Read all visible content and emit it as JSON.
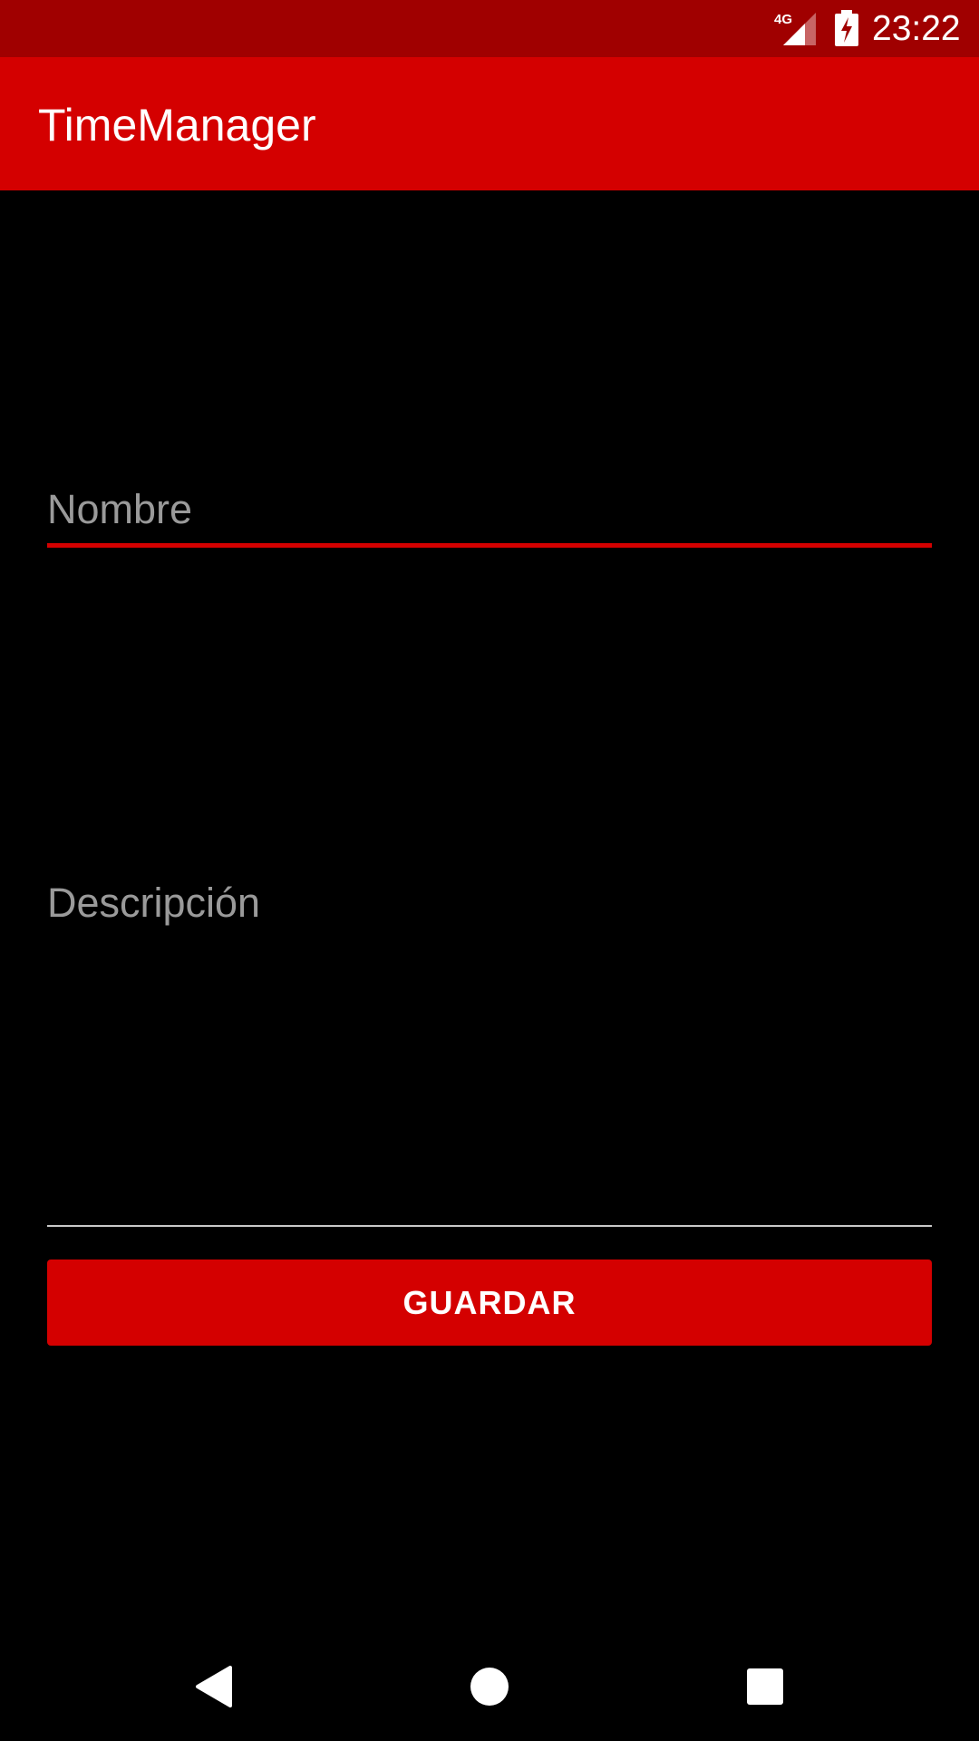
{
  "status_bar": {
    "network_label": "4G",
    "time": "23:22"
  },
  "app_bar": {
    "title": "TimeManager"
  },
  "form": {
    "name_field": {
      "placeholder": "Nombre",
      "value": ""
    },
    "description_field": {
      "placeholder": "Descripción",
      "value": ""
    },
    "save_button_label": "GUARDAR"
  },
  "nav_bar": {
    "icons": [
      "back-icon",
      "home-icon",
      "recents-icon"
    ]
  },
  "colors": {
    "status_bar": "#a00000",
    "accent": "#d40000",
    "background": "#000000",
    "hint_text": "#9a9a9a"
  }
}
